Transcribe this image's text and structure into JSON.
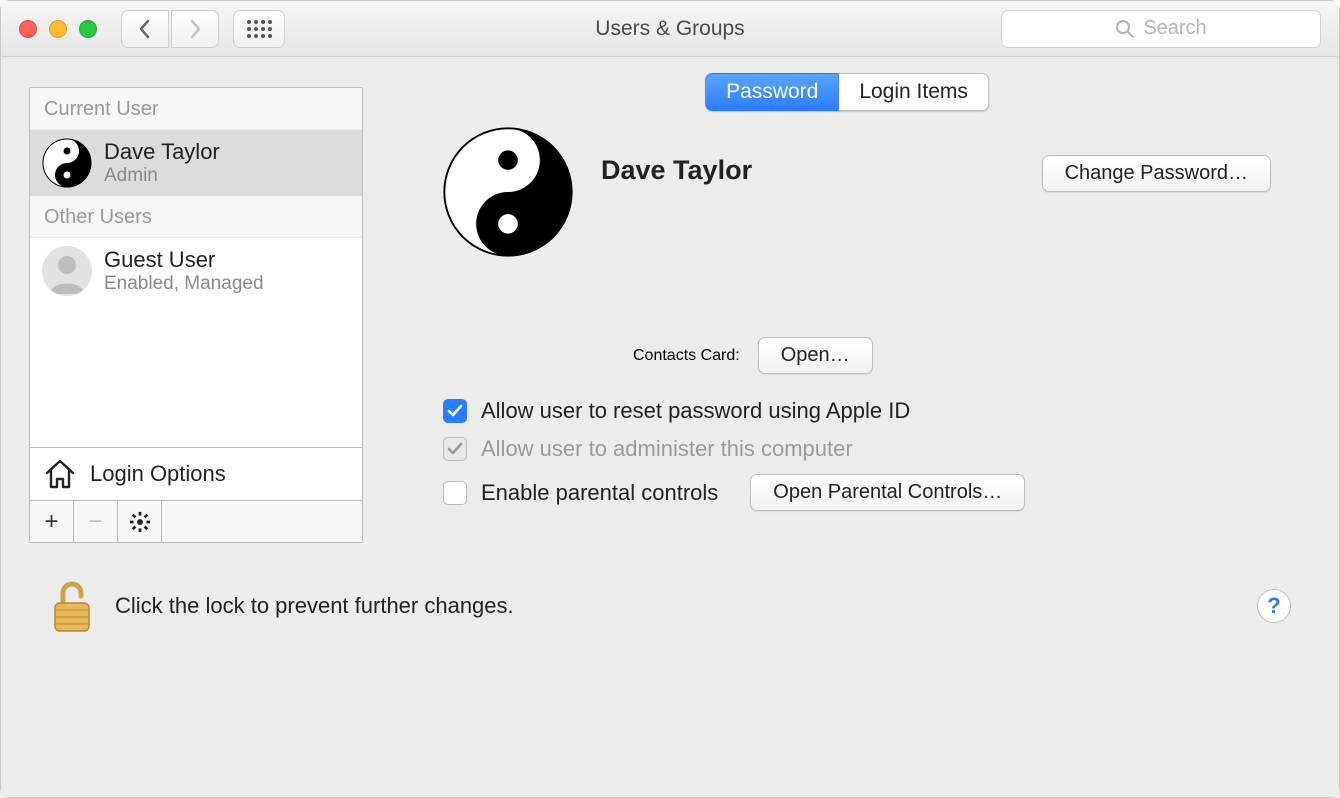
{
  "window": {
    "title": "Users & Groups"
  },
  "search": {
    "placeholder": "Search"
  },
  "sidebar": {
    "current_header": "Current User",
    "other_header": "Other Users",
    "users": [
      {
        "name": "Dave Taylor",
        "sub": "Admin",
        "avatar": "yinyang",
        "selected": true
      },
      {
        "name": "Guest User",
        "sub": "Enabled, Managed",
        "avatar": "silhouette",
        "selected": false
      }
    ],
    "login_options": "Login Options"
  },
  "tabs": {
    "password": "Password",
    "login_items": "Login Items",
    "active": "password"
  },
  "detail": {
    "user_name": "Dave Taylor",
    "change_password": "Change Password…",
    "contacts_label": "Contacts Card:",
    "contacts_open": "Open…",
    "allow_reset": "Allow user to reset password using Apple ID",
    "allow_admin": "Allow user to administer this computer",
    "enable_parental": "Enable parental controls",
    "open_parental": "Open Parental Controls…",
    "checks": {
      "allow_reset": true,
      "allow_admin": true,
      "enable_parental": false
    }
  },
  "footer": {
    "lock_text": "Click the lock to prevent further changes."
  }
}
